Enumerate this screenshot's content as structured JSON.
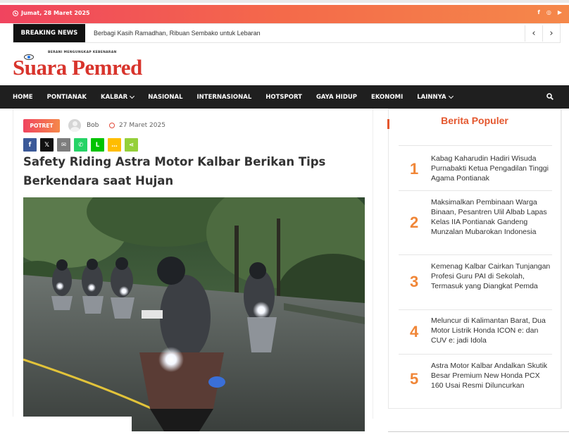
{
  "topbar": {
    "date": "Jumat, 28 Maret 2025",
    "social_icons": [
      "facebook-icon",
      "instagram-icon",
      "youtube-icon"
    ]
  },
  "breaking": {
    "label": "BREAKING NEWS",
    "headline": "Berbagi Kasih Ramadhan, Ribuan Sembako untuk Lebaran",
    "prev": "‹",
    "next": "›"
  },
  "logo": {
    "tagline": "BERANI MENGUNGKAP KEBENARAN",
    "name": "Suara Pemred"
  },
  "nav": {
    "items": [
      "HOME",
      "PONTIANAK",
      "KALBAR",
      "NASIONAL",
      "INTERNASIONAL",
      "HOTSPORT",
      "GAYA HIDUP",
      "EKONOMI",
      "LAINNYA"
    ]
  },
  "article": {
    "category": "POTRET",
    "author": "Bob",
    "date": "27 Maret 2025",
    "title": "Safety Riding Astra Motor Kalbar Berikan Tips Berkendara saat Hujan",
    "share": [
      {
        "icon": "facebook-icon",
        "glyph": "f",
        "color": "#3b5998"
      },
      {
        "icon": "x-icon",
        "glyph": "𝕏",
        "color": "#111111"
      },
      {
        "icon": "email-icon",
        "glyph": "✉",
        "color": "#7d7d7d"
      },
      {
        "icon": "whatsapp-icon",
        "glyph": "✆",
        "color": "#25d366"
      },
      {
        "icon": "line-icon",
        "glyph": "L",
        "color": "#00c300"
      },
      {
        "icon": "sms-icon",
        "glyph": "…",
        "color": "#ffbd00"
      },
      {
        "icon": "share-icon",
        "glyph": "⋖",
        "color": "#95d03a"
      }
    ]
  },
  "sidebar": {
    "title": "Berita Populer",
    "items": [
      {
        "num": "1",
        "text": "Kabag Kaharudin Hadiri Wisuda Purnabakti Ketua Pengadilan Tinggi Agama Pontianak"
      },
      {
        "num": "2",
        "text": "Maksimalkan Pembinaan Warga Binaan, Pesantren Ulil Albab Lapas Kelas IIA Pontianak Gandeng Munzalan Mubarokan Indonesia"
      },
      {
        "num": "3",
        "text": "Kemenag Kalbar Cairkan Tunjangan Profesi Guru PAI di Sekolah, Termasuk yang Diangkat Pemda"
      },
      {
        "num": "4",
        "text": "Meluncur di Kalimantan Barat, Dua Motor Listrik Honda ICON e: dan CUV e: jadi Idola"
      },
      {
        "num": "5",
        "text": "Astra Motor Kalbar Andalkan Skutik Besar Premium New Honda PCX 160 Usai Resmi Diluncurkan"
      }
    ]
  },
  "colors": {
    "accent_start": "#f0445f",
    "accent_end": "#f5884a",
    "nav_bg": "#1f1f1f",
    "logo_red": "#d8342c",
    "popular_number": "#f08637"
  }
}
